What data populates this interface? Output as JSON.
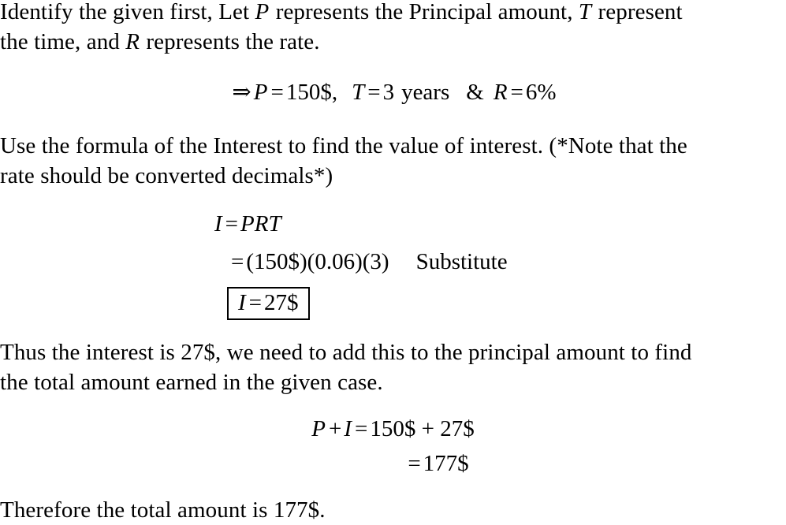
{
  "document": {
    "type": "math-solution",
    "topic": "Simple Interest",
    "background_color": "#ffffff",
    "text_color": "#000000"
  },
  "paragraph1": {
    "line1": "Identify the given first, Let P represents the Principal amount, T represent",
    "line2": "the time, and R represents the rate.",
    "seg": {
      "a": "Identify the given first, Let ",
      "var_p": "P",
      "b": " represents the Principal amount, ",
      "var_t": "T",
      "c": " represent",
      "d": "the time, and ",
      "var_r": "R",
      "e": " represents the rate."
    }
  },
  "given_equation": {
    "arrow": "⇒",
    "var_p": "P",
    "eq1": "=",
    "principal": "150$,",
    "var_t": "T",
    "eq2": "=",
    "time": "3",
    "time_unit": "years",
    "ampersand": "&",
    "var_r": "R",
    "eq3": "=",
    "rate": "6%",
    "full_text": "⇒ P = 150$, T = 3 years & R = 6%"
  },
  "paragraph2": {
    "line1": "Use the formula of the Interest to find the value of interest. (*Note that the",
    "line2": "rate should be converted decimals*)"
  },
  "derivation": {
    "row1": {
      "lhs_var": "I",
      "eq": "=",
      "rhs": "PRT",
      "full_text": "I = PRT"
    },
    "row2": {
      "eq": "=",
      "rhs": "(150$)(0.06)(3)",
      "annotation": "Substitute",
      "full_text": "= (150$)(0.06)(3)    Substitute"
    },
    "row3_boxed": {
      "lhs_var": "I",
      "eq": "=",
      "rhs": "27$",
      "full_text": "I = 27$",
      "has_border": true
    }
  },
  "paragraph3": {
    "line1": "Thus the interest is 27$, we need to add this to the principal amount to find",
    "line2": "the total amount earned in the given case."
  },
  "final_equation": {
    "row1": {
      "var_p": "P",
      "plus": "+",
      "var_i": "I",
      "eq": "=",
      "rhs": "150$ + 27$",
      "full_text": "P + I = 150$ + 27$"
    },
    "row2": {
      "eq": "=",
      "rhs": "177$",
      "full_text": "= 177$"
    }
  },
  "conclusion": {
    "text": "Therefore the total amount is 177$."
  }
}
